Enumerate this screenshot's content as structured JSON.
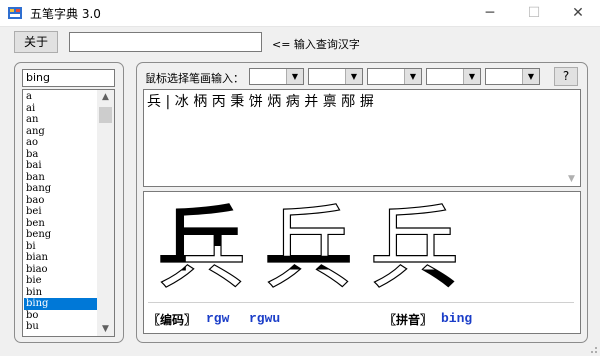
{
  "window": {
    "title": "五笔字典 3.0",
    "minimize_glyph": "─",
    "maximize_glyph": "☐",
    "close_glyph": "✕"
  },
  "toolbar": {
    "about_label": "关于",
    "lookup_value": "",
    "lookup_hint": "<= 输入查询汉字"
  },
  "pinyin_panel": {
    "search_value": "bing",
    "items": [
      "a",
      "ai",
      "an",
      "ang",
      "ao",
      "ba",
      "bai",
      "ban",
      "bang",
      "bao",
      "bei",
      "ben",
      "beng",
      "bi",
      "bian",
      "biao",
      "bie",
      "bin",
      "bing",
      "bo",
      "bu"
    ],
    "selected": "bing",
    "scroll_up": "▲",
    "scroll_down": "▼"
  },
  "stroke_panel": {
    "label": "鼠标选择笔画输入：",
    "help_label": "?",
    "combo_arrow": "▼"
  },
  "results": {
    "chars": "兵|冰柄丙秉饼炳病并禀邴摒"
  },
  "glyph_display": {
    "character": "兵",
    "wubi_label": "〖编码〗",
    "wubi_codes": [
      "rgw",
      "rgwu"
    ],
    "pinyin_label": "〖拼音〗",
    "pinyin": "bing"
  },
  "colors": {
    "selection": "#0078d7",
    "code_text": "#1a3dc8"
  }
}
